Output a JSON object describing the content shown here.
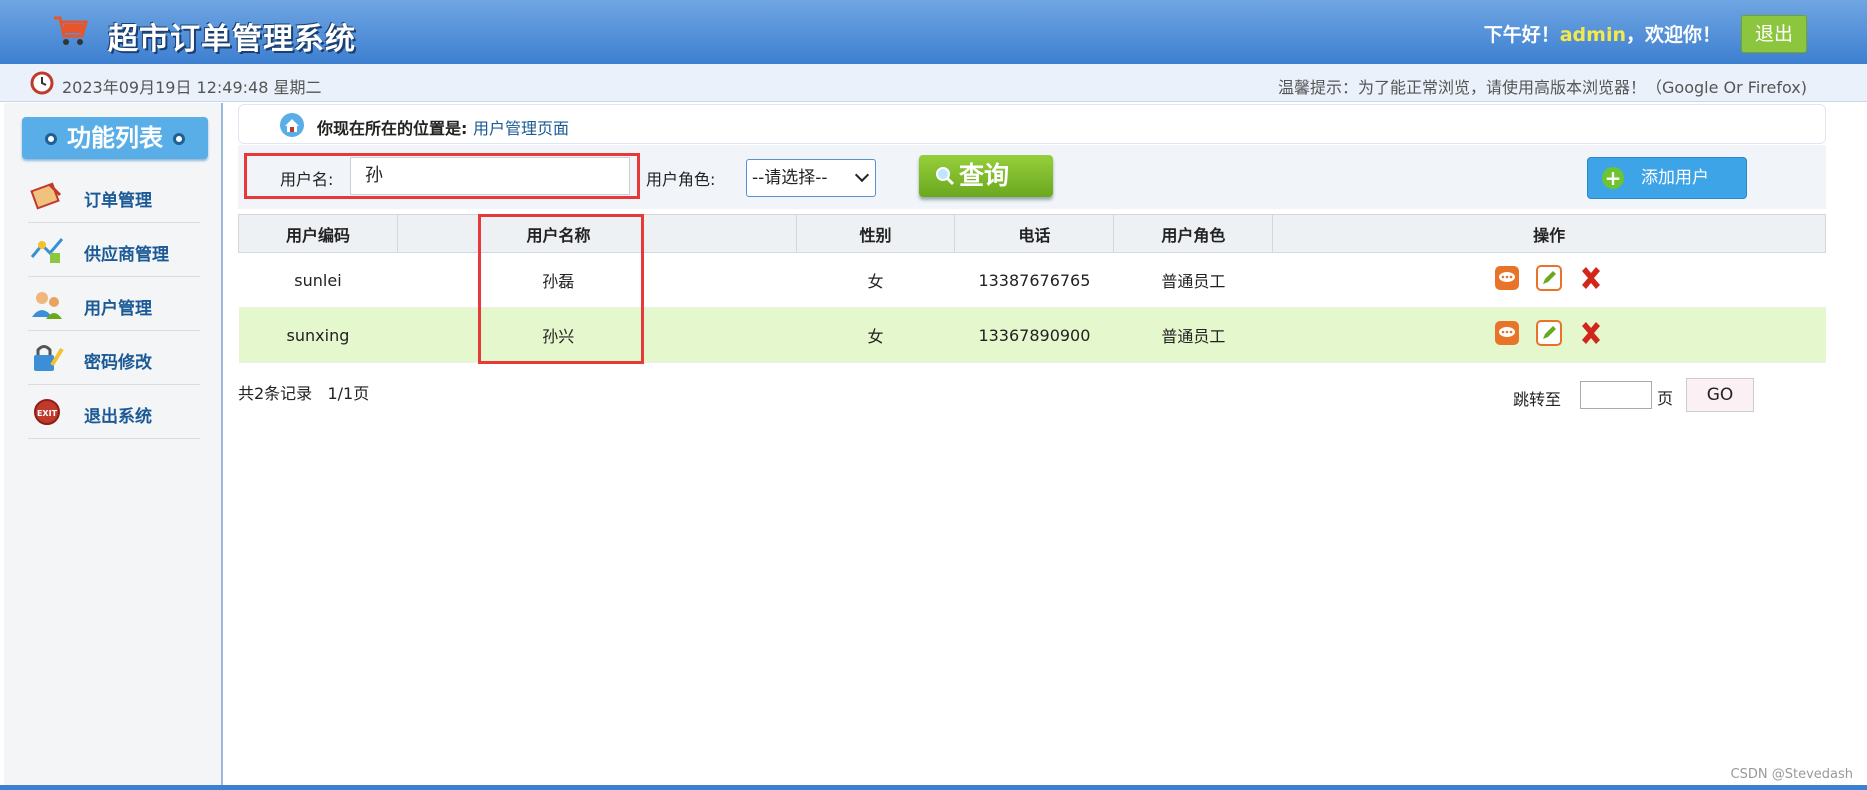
{
  "header": {
    "title": "超市订单管理系统",
    "greeting_prefix": "下午好！",
    "username": "admin",
    "greeting_suffix": "，欢迎你！",
    "logout_label": "退出"
  },
  "infobar": {
    "datetime": "2023年09月19日 12:49:48 星期二",
    "tip": "温馨提示：为了能正常浏览，请使用高版本浏览器！（Google Or Firefox)"
  },
  "sidebar": {
    "title": "功能列表",
    "items": [
      {
        "label": "订单管理",
        "icon": "order-icon"
      },
      {
        "label": "供应商管理",
        "icon": "supplier-icon"
      },
      {
        "label": "用户管理",
        "icon": "users-icon"
      },
      {
        "label": "密码修改",
        "icon": "password-icon"
      },
      {
        "label": "退出系统",
        "icon": "exit-icon"
      }
    ]
  },
  "breadcrumb": {
    "prefix": "你现在所在的位置是:",
    "current": "用户管理页面"
  },
  "search": {
    "username_label": "用户名:",
    "username_value": "孙",
    "role_label": "用户角色:",
    "role_selected": "--请选择--",
    "query_label": "查询",
    "add_label": "添加用户"
  },
  "table": {
    "headers": [
      "用户编码",
      "用户名称",
      "性别",
      "电话",
      "用户角色",
      "操作"
    ],
    "rows": [
      {
        "code": "sunlei",
        "name": "孙磊",
        "gender": "女",
        "phone": "13387676765",
        "role": "普通员工"
      },
      {
        "code": "sunxing",
        "name": "孙兴",
        "gender": "女",
        "phone": "13367890900",
        "role": "普通员工"
      }
    ]
  },
  "pagination": {
    "total": "共2条记录",
    "page": "1/1页",
    "jump_label": "跳转至",
    "page_unit": "页",
    "go_label": "GO"
  },
  "watermark": "CSDN @Stevedash",
  "colors": {
    "header_blue": "#3d7fd0",
    "accent_green": "#8cc63f",
    "highlight_red": "#e63a3a",
    "row_alt": "#e5f7cc"
  }
}
